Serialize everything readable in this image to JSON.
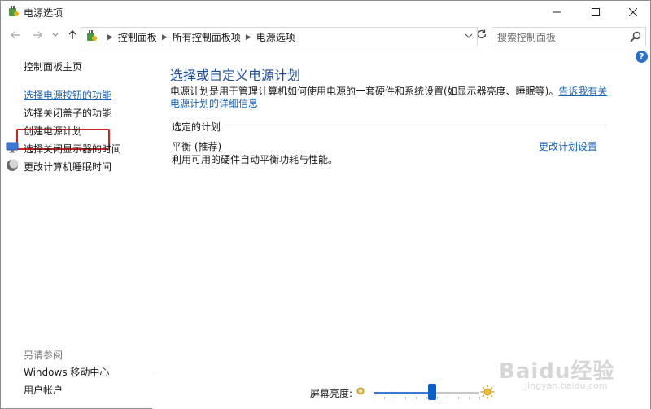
{
  "window": {
    "title": "电源选项",
    "controls": {
      "min": "—",
      "max": "☐",
      "close": "✕"
    }
  },
  "address": {
    "breadcrumbs": [
      "控制面板",
      "所有控制面板项",
      "电源选项"
    ],
    "search_placeholder": "搜索控制面板"
  },
  "help": {
    "label": "?"
  },
  "sidebar": {
    "home": "控制面板主页",
    "items": [
      {
        "label": "选择电源按钮的功能",
        "icon": "none",
        "highlighted": true
      },
      {
        "label": "选择关闭盖子的功能",
        "icon": "none"
      },
      {
        "label": "创建电源计划",
        "icon": "none"
      },
      {
        "label": "选择关闭显示器的时间",
        "icon": "monitor-icon"
      },
      {
        "label": "更改计算机睡眠时间",
        "icon": "moon-icon"
      }
    ],
    "see_also_label": "另请参阅",
    "see_also": [
      "Windows 移动中心",
      "用户帐户"
    ]
  },
  "main": {
    "title": "选择或自定义电源计划",
    "description": "电源计划是用于管理计算机如何使用电源的一套硬件和系统设置(如显示器亮度、睡眠等)。",
    "description_link": "告诉我有关电源计划的详细信息",
    "section_label": "选定的计划",
    "plan": {
      "name": "平衡 (推荐)",
      "description": "利用可用的硬件自动平衡功耗与性能。",
      "settings_link": "更改计划设置"
    }
  },
  "brightness": {
    "label": "屏幕亮度:",
    "level_percent": 55
  },
  "watermark": {
    "text": "Baidu经验",
    "url": "jingyan.baidu.com"
  },
  "colors": {
    "link": "#1a64b8",
    "title": "#1f4e9a",
    "highlight_box": "#d42020",
    "slider": "#0a5fc9"
  }
}
